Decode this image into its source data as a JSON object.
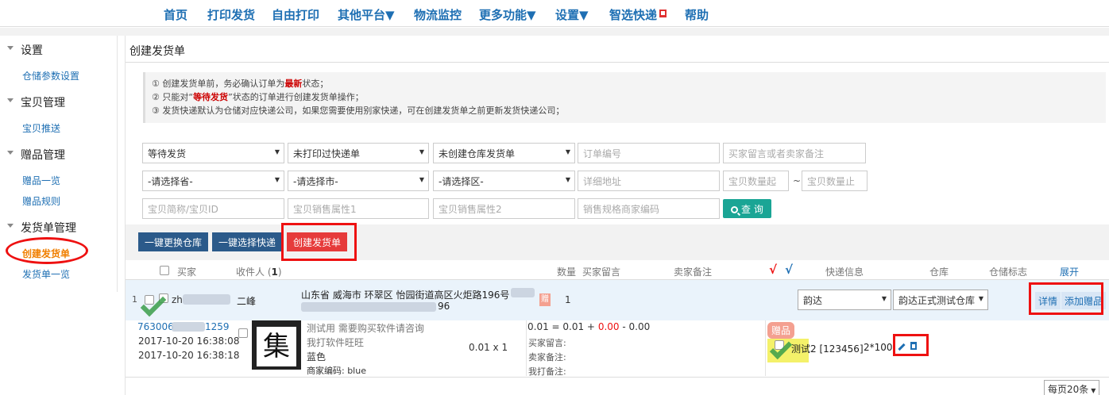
{
  "topnav": {
    "items": [
      "首页",
      "打印发货",
      "自由打印",
      "其他平台▼",
      "物流监控",
      "更多功能▼",
      "设置▼",
      "智选快递",
      "帮助"
    ]
  },
  "sidebar": {
    "groups": [
      {
        "title": "设置",
        "links": [
          "仓储参数设置"
        ]
      },
      {
        "title": "宝贝管理",
        "links": [
          "宝贝推送"
        ]
      },
      {
        "title": "赠品管理",
        "links": [
          "赠品一览",
          "赠品规则"
        ]
      },
      {
        "title": "发货单管理",
        "links": [
          "创建发货单",
          "发货单一览"
        ]
      }
    ],
    "active_link": "创建发货单"
  },
  "page": {
    "title": "创建发货单",
    "notice": {
      "l1_a": "① 创建发货单前，务必确认订单为",
      "l1_hl": "最新",
      "l1_b": "状态；",
      "l2_a": "② 只能对“",
      "l2_hl": "等待发货",
      "l2_b": "”状态的订单进行创建发货单操作；",
      "l3": "③ 发货快递默认为仓储对应快递公司，如果您需要使用别家快递，可在创建发货单之前更新发货快递公司；"
    }
  },
  "filters": {
    "status": "等待发货",
    "print_status": "未打印过快递单",
    "warehouse_status": "未创建仓库发货单",
    "order_no_ph": "订单编号",
    "remark_ph": "买家留言或者卖家备注",
    "province": "-请选择省-",
    "city": "-请选择市-",
    "district": "-请选择区-",
    "address_ph": "详细地址",
    "qty_from_ph": "宝贝数量起",
    "tilde": "~",
    "qty_to_ph": "宝贝数量止",
    "item_name_ph": "宝贝简称/宝贝ID",
    "attr1_ph": "宝贝销售属性1",
    "attr2_ph": "宝贝销售属性2",
    "sku_code_ph": "销售规格商家编码",
    "query_label": "查 询"
  },
  "actions": {
    "change_warehouse": "一键更换仓库",
    "choose_express": "一键选择快递",
    "create_invoice": "创建发货单"
  },
  "table_header": {
    "buyer": "买家",
    "receiver": "收件人 (",
    "receiver_count": "1",
    "receiver_close": ")",
    "qty": "数量",
    "buyer_msg": "买家留言",
    "seller_note": "卖家备注",
    "check_red": "√",
    "check_blue": "√",
    "express_info": "快递信息",
    "warehouse": "仓库",
    "warehouse_flag": "仓储标志",
    "expand": "展开"
  },
  "order": {
    "index": "1",
    "buyer_prefix": "zh",
    "receiver": "二峰",
    "address": "山东省 威海市 环翠区 怡园街道高区火炬路196号",
    "phone_suffix": "96",
    "gift_mark": "赠",
    "qty": "1",
    "express": "韵达",
    "warehouse": "韵达正式测试仓库",
    "detail_btn": "详情",
    "add_gift_btn": "添加赠品"
  },
  "item": {
    "order_no_prefix": "763006",
    "order_no_suffix": "1259",
    "time1": "2017-10-20 16:38:08",
    "time2": "2017-10-20 16:38:18",
    "icon_char": "集",
    "name": "测试用 需要购买软件请咨询",
    "shop": "我打软件旺旺",
    "color": "蓝色",
    "merchant_code": "商家编码: blue",
    "price_qty": "0.01 x 1",
    "formula_a": "0.01 = 0.01 + ",
    "formula_red": "0.00",
    "formula_b": " - 0.00",
    "buyer_msg_label": "买家留言:",
    "seller_note_label": "卖家备注:",
    "my_note_label": "我打备注:",
    "gift_badge": "赠品",
    "gift_name": "测试2 [123456]",
    "gift_qty": "2*100"
  },
  "pager": {
    "per_page": "每页20条"
  },
  "colors": {
    "nav_blue": "#1e6fb3",
    "accent_red": "#e63b3b",
    "query_teal": "#1aa595",
    "dark_btn": "#2b5a8a",
    "active_orange": "#f07f00"
  }
}
